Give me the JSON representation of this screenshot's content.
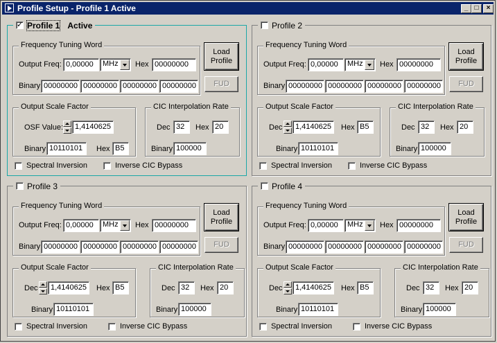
{
  "window": {
    "title": "Profile Setup - Profile 1 Active",
    "minimize_glyph": "_",
    "maximize_glyph": "□",
    "close_glyph": "×"
  },
  "labels": {
    "ftw": "Frequency Tuning Word",
    "output_freq": "Output Freq:",
    "hex": "Hex",
    "binary": "Binary",
    "load_profile": "Load Profile",
    "fud": "FUD",
    "osf": "Output Scale Factor",
    "osf_value": "OSF Value:",
    "dec": "Dec",
    "cic": "CIC Interpolation Rate",
    "spectral_inversion": "Spectral Inversion",
    "inverse_cic_bypass": "Inverse CIC Bypass",
    "active": "Active"
  },
  "profiles": [
    {
      "name": "Profile 1",
      "enabled": true,
      "active": true,
      "output_freq": "0,00000",
      "freq_unit": "MHz",
      "ftw_hex": "00000000",
      "ftw_binary": [
        "00000000",
        "00000000",
        "00000000",
        "00000000"
      ],
      "osf_value": "1,4140625",
      "osf_hex": "B5",
      "osf_binary": "10110101",
      "cic_dec": "32",
      "cic_hex": "20",
      "cic_binary": "100000",
      "spectral_inversion": false,
      "inverse_cic_bypass": false
    },
    {
      "name": "Profile 2",
      "enabled": false,
      "active": false,
      "output_freq": "0,00000",
      "freq_unit": "MHz",
      "ftw_hex": "00000000",
      "ftw_binary": [
        "00000000",
        "00000000",
        "00000000",
        "00000000"
      ],
      "osf_value": "1,4140625",
      "osf_hex": "B5",
      "osf_binary": "10110101",
      "cic_dec": "32",
      "cic_hex": "20",
      "cic_binary": "100000",
      "spectral_inversion": false,
      "inverse_cic_bypass": false
    },
    {
      "name": "Profile 3",
      "enabled": false,
      "active": false,
      "output_freq": "0,00000",
      "freq_unit": "MHz",
      "ftw_hex": "00000000",
      "ftw_binary": [
        "00000000",
        "00000000",
        "00000000",
        "00000000"
      ],
      "osf_value": "1,4140625",
      "osf_hex": "B5",
      "osf_binary": "10110101",
      "cic_dec": "32",
      "cic_hex": "20",
      "cic_binary": "100000",
      "spectral_inversion": false,
      "inverse_cic_bypass": false
    },
    {
      "name": "Profile 4",
      "enabled": false,
      "active": false,
      "output_freq": "0,00000",
      "freq_unit": "MHz",
      "ftw_hex": "00000000",
      "ftw_binary": [
        "00000000",
        "00000000",
        "00000000",
        "00000000"
      ],
      "osf_value": "1,4140625",
      "osf_hex": "B5",
      "osf_binary": "10110101",
      "cic_dec": "32",
      "cic_hex": "20",
      "cic_binary": "100000",
      "spectral_inversion": false,
      "inverse_cic_bypass": false
    }
  ]
}
